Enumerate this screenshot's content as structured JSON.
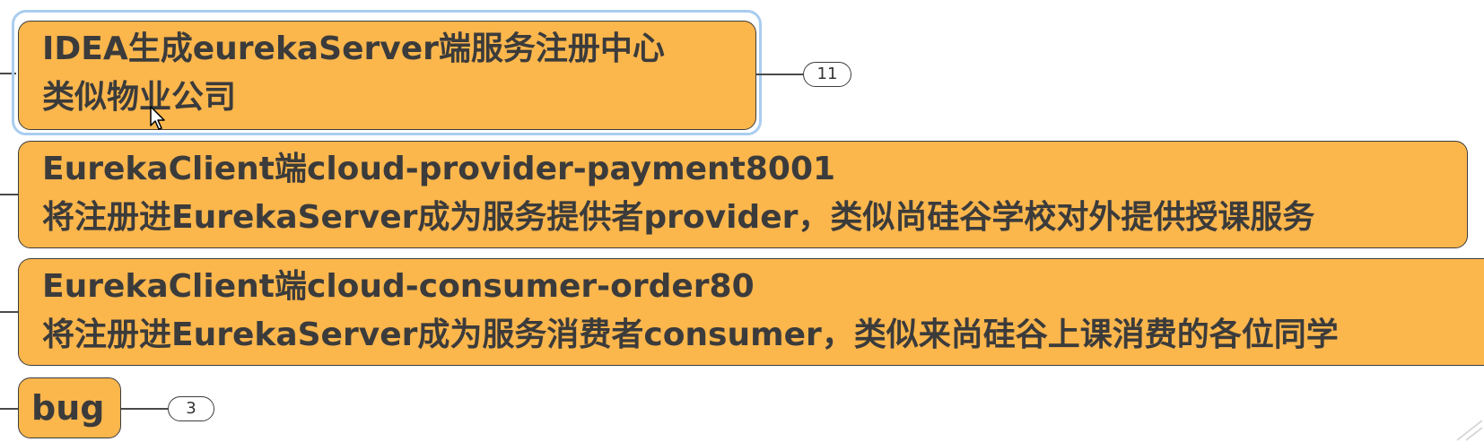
{
  "topics": [
    {
      "lines": [
        "IDEA生成eurekaServer端服务注册中心",
        "类似物业公司"
      ],
      "badge": "11",
      "selected": true
    },
    {
      "lines": [
        "EurekaClient端cloud-provider-payment8001",
        "将注册进EurekaServer成为服务提供者provider，类似尚硅谷学校对外提供授课服务"
      ]
    },
    {
      "lines": [
        "EurekaClient端cloud-consumer-order80",
        "将注册进EurekaServer成为服务消费者consumer，类似来尚硅谷上课消费的各位同学"
      ]
    },
    {
      "lines": [
        "bug"
      ],
      "badge": "3"
    }
  ],
  "colors": {
    "topic_fill": "#fbb64c",
    "topic_border": "#3d3d3d",
    "selection": "#a9cdf0",
    "text": "#3b3b3b"
  },
  "icons": {
    "cursor": "arrow-pointer-icon"
  }
}
